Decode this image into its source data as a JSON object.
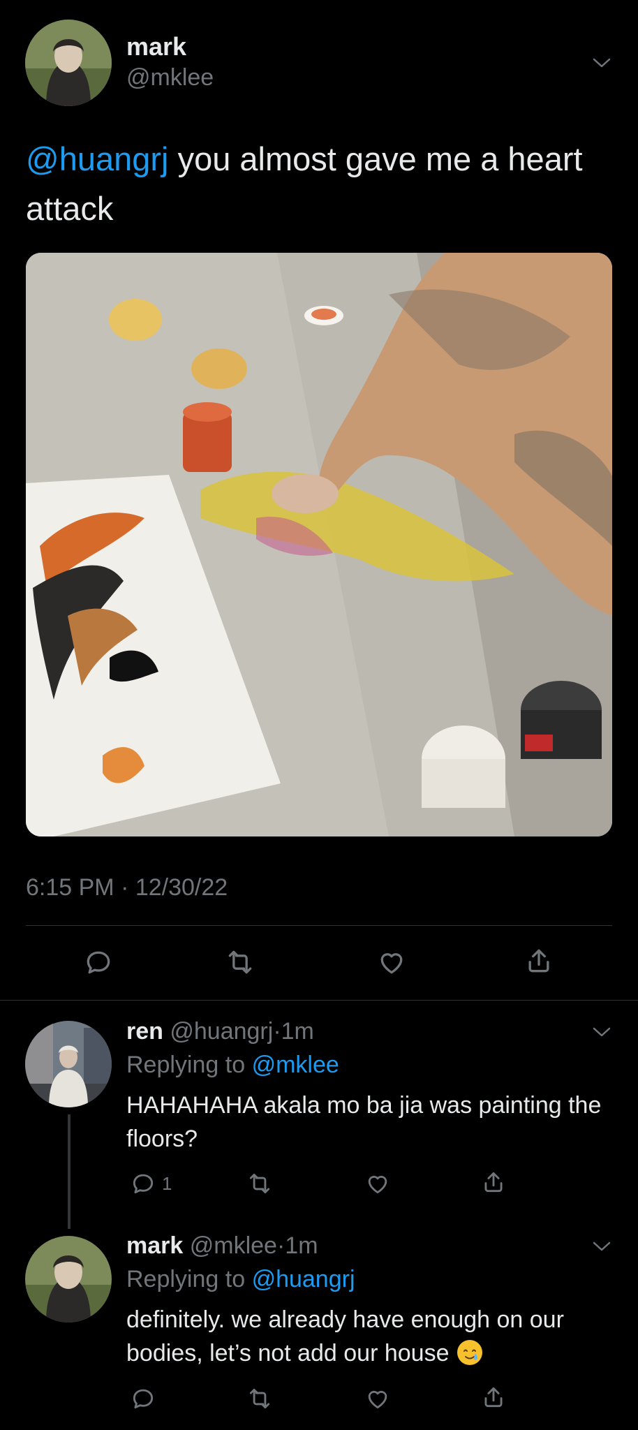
{
  "main_tweet": {
    "display_name": "mark",
    "handle": "@mklee",
    "mention": "@huangrj",
    "text": " you almost gave me a heart attack",
    "time": "6:15 PM",
    "date": "12/30/22"
  },
  "replies": [
    {
      "display_name": "ren",
      "handle": "@huangrj",
      "age": "1m",
      "replying_label": "Replying to",
      "replying_to": "@mklee",
      "text": "HAHAHAHA akala mo ba jia was painting the floors?",
      "reply_count": "1"
    },
    {
      "display_name": "mark",
      "handle": "@mklee",
      "age": "1m",
      "replying_label": "Replying to",
      "replying_to": "@huangrj",
      "text": "definitely. we already have enough on our bodies, let’s not add our house",
      "emoji": "🥲"
    }
  ],
  "icons": [
    "chevron-down-icon",
    "reply-icon",
    "retweet-icon",
    "like-icon",
    "share-icon"
  ],
  "colors": {
    "background": "#000000",
    "text": "#e7e9ea",
    "muted": "#71767b",
    "link": "#1d9bf0",
    "divider": "#2f3336"
  }
}
